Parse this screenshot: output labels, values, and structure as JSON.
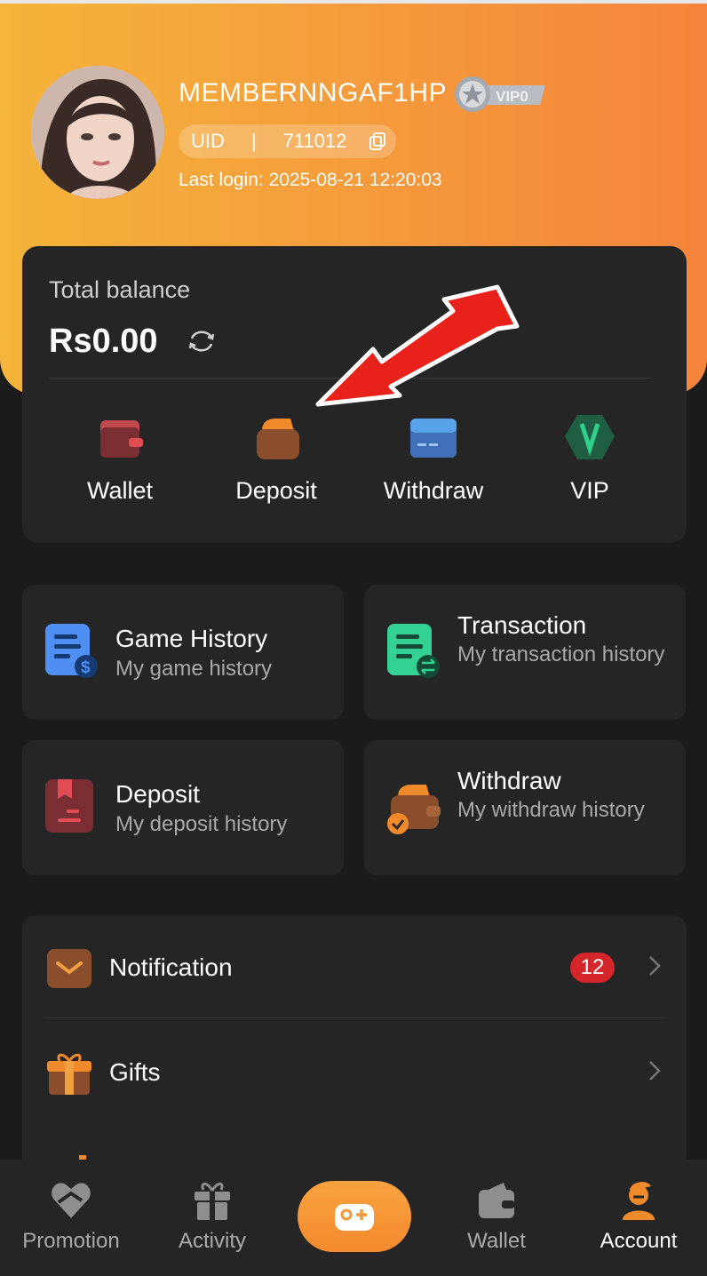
{
  "profile": {
    "username": "MEMBERNNGAF1HP",
    "vip_badge": "VIP0",
    "uid_label": "UID",
    "uid_separator": "|",
    "uid_value": "711012",
    "last_login": "Last login: 2025-08-21 12:20:03"
  },
  "balance": {
    "label": "Total balance",
    "amount": "Rs0.00"
  },
  "quick_actions": [
    {
      "label": "Wallet",
      "icon": "wallet-icon"
    },
    {
      "label": "Deposit",
      "icon": "deposit-icon"
    },
    {
      "label": "Withdraw",
      "icon": "withdraw-card-icon"
    },
    {
      "label": "VIP",
      "icon": "vip-icon"
    }
  ],
  "history_tiles": [
    {
      "title": "Game History",
      "subtitle": "My game history",
      "icon": "game-history-icon"
    },
    {
      "title": "Transaction",
      "subtitle": "My transaction history",
      "icon": "transaction-icon"
    },
    {
      "title": "Deposit",
      "subtitle": "My deposit history",
      "icon": "deposit-history-icon"
    },
    {
      "title": "Withdraw",
      "subtitle": "My withdraw history",
      "icon": "withdraw-history-icon"
    }
  ],
  "list": [
    {
      "label": "Notification",
      "badge": "12",
      "icon": "mail-icon"
    },
    {
      "label": "Gifts",
      "icon": "gift-icon"
    }
  ],
  "bottom_nav": [
    {
      "label": "Promotion",
      "icon": "promotion-icon"
    },
    {
      "label": "Activity",
      "icon": "activity-icon"
    },
    {
      "label": "",
      "icon": "gamepad-icon"
    },
    {
      "label": "Wallet",
      "icon": "wallet-icon"
    },
    {
      "label": "Account",
      "icon": "account-icon",
      "active": true
    }
  ],
  "colors": {
    "accent": "#f59a3c",
    "badge": "#d3252a",
    "annotation_arrow": "#e8221b"
  }
}
